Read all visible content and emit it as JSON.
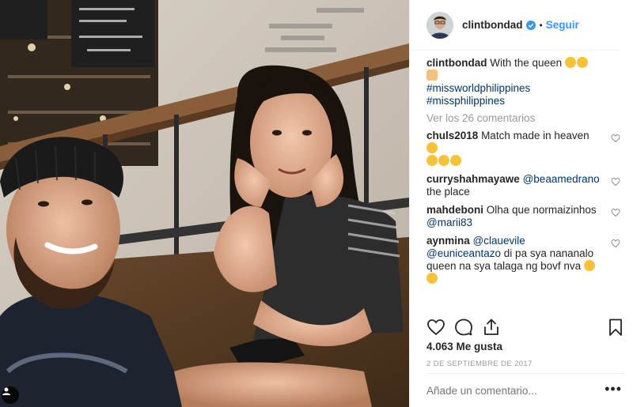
{
  "post": {
    "username": "clintbondad",
    "verified": true,
    "follow_label": "Seguir",
    "separator": "•"
  },
  "caption": {
    "username": "clintbondad",
    "text": "With the queen",
    "emojis": [
      "smiling-face-emoji",
      "heart-eyes-emoji",
      "victory-hand-emoji"
    ],
    "hashtags": [
      "#missworldphilippines",
      "#missphilippines"
    ]
  },
  "view_all_comments": "Ver los 26 comentarios",
  "comments": [
    {
      "username": "chuls2018",
      "text": "Match made in heaven",
      "emojis_after": [
        "kissing-heart-emoji",
        "kissing-heart-emoji",
        "kissing-heart-emoji",
        "heart-eyes-emoji"
      ]
    },
    {
      "username": "curryshahmayawe",
      "mention": "@beaamedrano",
      "text": "the place"
    },
    {
      "username": "mahdeboni",
      "text": "Olha que normaizinhos",
      "mention": "@marii83"
    },
    {
      "username": "aynmina",
      "mention1": "@clauevile",
      "mention2": "@euniceantazo",
      "text": "di pa sya nananalo queen na sya talaga ng bovf nva",
      "emojis_after": [
        "tears-of-joy-emoji",
        "pleading-face-emoji"
      ]
    }
  ],
  "likes": "4.063 Me gusta",
  "date": "2 DE SEPTIEMBRE DE 2017",
  "add_comment_placeholder": "Añade un comentario...",
  "more_label": "•••",
  "colors": {
    "link": "#3897f0",
    "mention": "#003569",
    "muted": "#999999",
    "text": "#262626"
  }
}
